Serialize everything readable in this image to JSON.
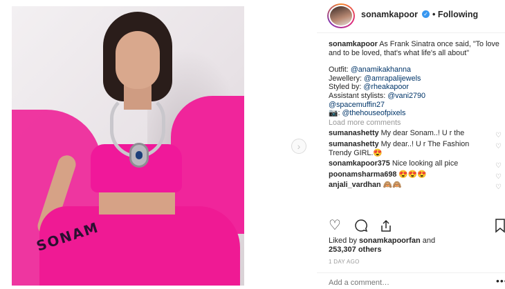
{
  "post": {
    "username": "sonamkapoor",
    "verified_icon": "verified-badge-icon",
    "following_label": "• Following",
    "print_text": "SONAM"
  },
  "caption": {
    "author": "sonamkapoor",
    "text": "As Frank Sinatra once said, \"To love and to be loved, that's what life's all about\"",
    "outfit_label": "Outfit: ",
    "outfit_handle": "@anamikakhanna",
    "jewellery_label": "Jewellery: ",
    "jewellery_handle": "@amrapalijewels",
    "styled_label": "Styled by: ",
    "styled_handle": "@rheakapoor",
    "assistant_label": "Assistant stylists: ",
    "assistant_handle1": "@vani2790",
    "assistant_handle2": "@spacemuffin27",
    "camera_emoji": "📷",
    "camera_sep": ": ",
    "photo_handle": "@thehouseofpixels"
  },
  "load_more": "Load more comments",
  "comments": [
    {
      "user": "sumanashetty",
      "text": "My dear Sonam..! U r the"
    },
    {
      "user": "sumanashetty",
      "text": "My dear..! U r The Fashion Trendy GIRL.😍"
    },
    {
      "user": "sonamkapoor375",
      "text": "Nice looking all pice"
    },
    {
      "user": "poonamsharma698",
      "text": "😍😍😍"
    },
    {
      "user": "anjali_vardhan",
      "text": "🙈🙈"
    }
  ],
  "likes": {
    "prefix": "Liked by ",
    "user": "sonamkapoorfan",
    "middle": " and",
    "count": "253,307 others"
  },
  "timestamp": "1 DAY AGO",
  "comment_input": {
    "placeholder": "Add a comment…"
  },
  "more_label": "•••",
  "icons": {
    "heart": "heart-icon",
    "comment": "comment-icon",
    "share": "share-icon",
    "save": "bookmark-icon",
    "next": "chevron-right-icon"
  },
  "colors": {
    "link": "#003569",
    "verified": "#3897f0",
    "muted": "#999999",
    "text": "#262626",
    "outfit_pink": "#ef1a94"
  }
}
